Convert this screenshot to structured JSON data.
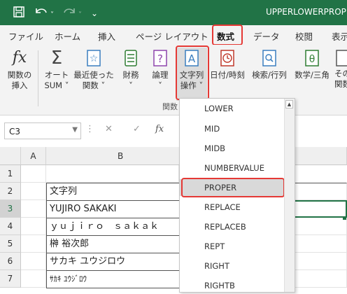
{
  "window": {
    "title": "UPPERLOWERPROPER"
  },
  "quick_access": {
    "save_icon": "save-icon",
    "undo_icon": "undo-icon",
    "redo_icon": "redo-icon"
  },
  "tabs": [
    "ファイル",
    "ホーム",
    "挿入",
    "ページ レイアウト",
    "数式",
    "データ",
    "校閲",
    "表示"
  ],
  "active_tab": "数式",
  "ribbon": {
    "insert_function": [
      "関数の",
      "挿入"
    ],
    "autosum": [
      "オート",
      "SUM ˅"
    ],
    "recent": [
      "最近使った",
      "関数 ˅"
    ],
    "financial": [
      "財務",
      "˅"
    ],
    "logical": [
      "論理",
      "˅"
    ],
    "text": [
      "文字列",
      "操作 ˅"
    ],
    "datetime": "日付/時刻",
    "lookup": "検索/行列",
    "math": "数学/三角",
    "more": [
      "その",
      "関数"
    ],
    "group_label": "関数"
  },
  "formula_bar": {
    "name_box": "C3",
    "fx": "fx"
  },
  "grid": {
    "columns": [
      "A",
      "B"
    ],
    "rows": [
      "1",
      "2",
      "3",
      "4",
      "5",
      "6",
      "7"
    ],
    "b_cells": [
      "",
      "文字列",
      "YUJIRO SAKAKI",
      "ｙｕｊｉｒｏ　ｓａｋａｋ",
      "榊 裕次郎",
      "サカキ ユウジロウ",
      "ｻｶｷ ﾕｳｼﾞﾛｳ"
    ]
  },
  "dropdown": {
    "items": [
      "LOWER",
      "MID",
      "MIDB",
      "NUMBERVALUE",
      "PROPER",
      "REPLACE",
      "REPLACEB",
      "REPT",
      "RIGHT",
      "RIGHTB"
    ],
    "selected": "PROPER"
  },
  "colors": {
    "title_bar": "#217346",
    "highlight": "#e53935",
    "selected_item": "#d9d9d9"
  }
}
